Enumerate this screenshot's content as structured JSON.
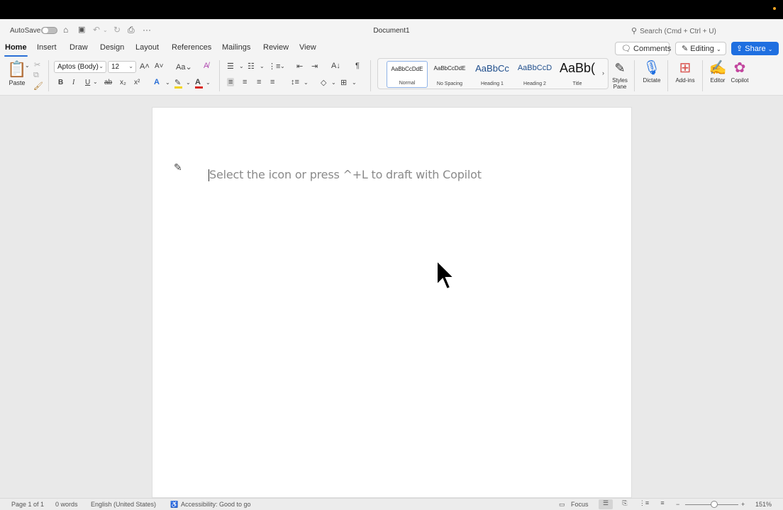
{
  "title_bar": {
    "autosave_label": "AutoSave",
    "document_title": "Document1",
    "search_placeholder": "Search (Cmd + Ctrl + U)"
  },
  "tabs": [
    "Home",
    "Insert",
    "Draw",
    "Design",
    "Layout",
    "References",
    "Mailings",
    "Review",
    "View"
  ],
  "active_tab": "Home",
  "actions": {
    "comments_label": "Comments",
    "editing_label": "Editing",
    "share_label": "Share"
  },
  "ribbon": {
    "paste_label": "Paste",
    "font_name": "Aptos (Body)",
    "font_size": "12",
    "styles": [
      {
        "sample": "AaBbCcDdE",
        "label": "Normal"
      },
      {
        "sample": "AaBbCcDdE",
        "label": "No Spacing"
      },
      {
        "sample": "AaBbCc",
        "label": "Heading 1"
      },
      {
        "sample": "AaBbCcD",
        "label": "Heading 2"
      },
      {
        "sample": "AaBb(",
        "label": "Title"
      }
    ],
    "styles_pane_label_line1": "Styles",
    "styles_pane_label_line2": "Pane",
    "dictate_label": "Dictate",
    "addins_label": "Add-ins",
    "editor_label": "Editor",
    "copilot_label": "Copilot"
  },
  "document": {
    "placeholder": "Select the icon or press ^+L to draft with Copilot"
  },
  "status_bar": {
    "page": "Page 1 of 1",
    "words": "0 words",
    "language": "English (United States)",
    "accessibility": "Accessibility: Good to go",
    "focus": "Focus",
    "zoom": "151%"
  },
  "colors": {
    "accent": "#2b6fd6",
    "share_button": "#1f6fe0",
    "highlight_yellow": "#f2d40f",
    "font_color_red": "#d9261c"
  }
}
